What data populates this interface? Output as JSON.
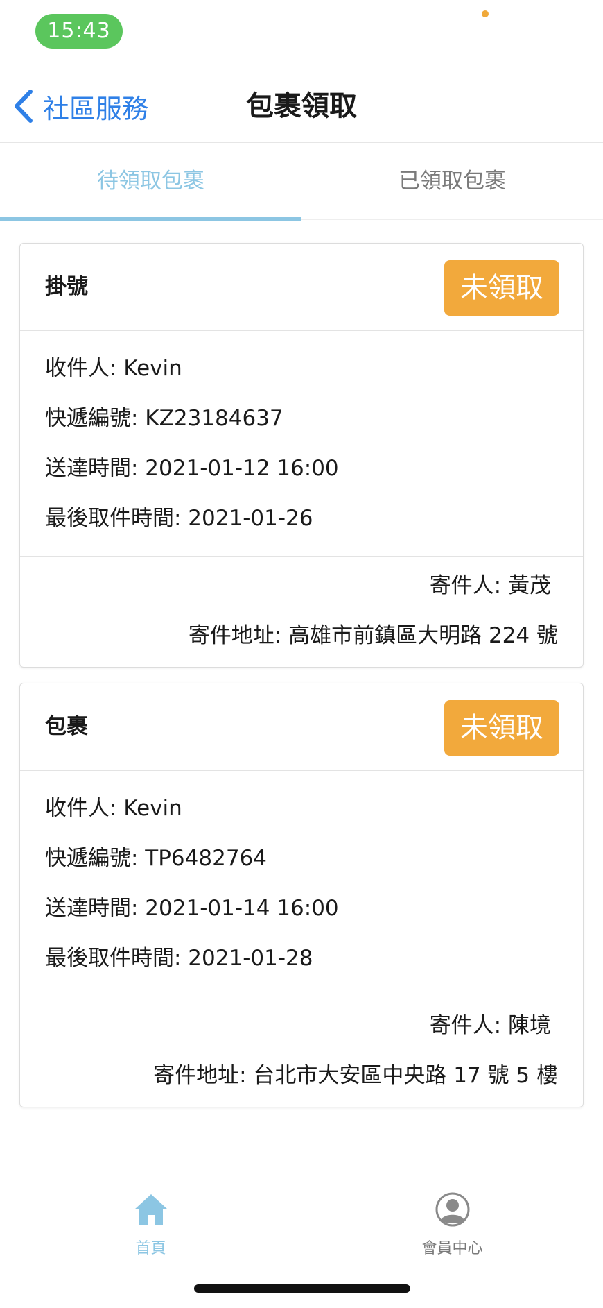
{
  "status_bar": {
    "time": "15:43"
  },
  "nav": {
    "back_label": "社區服務",
    "title": "包裹領取"
  },
  "tabs": [
    {
      "label": "待領取包裹",
      "active": true
    },
    {
      "label": "已領取包裹",
      "active": false
    }
  ],
  "colors": {
    "accent": "#8cc6e3",
    "back_link": "#2f80e7",
    "status_button": "#f2a93c",
    "time_pill": "#5bc65d"
  },
  "packages": [
    {
      "type": "掛號",
      "status": "未領取",
      "recipient": "收件人: Kevin",
      "tracking": "快遞編號: KZ23184637",
      "delivered": "送達時間: 2021-01-12 16:00",
      "deadline": "最後取件時間: 2021-01-26",
      "sender": "寄件人: 黃茂",
      "sender_address": "寄件地址: 高雄市前鎮區大明路 224 號"
    },
    {
      "type": "包裹",
      "status": "未領取",
      "recipient": "收件人: Kevin",
      "tracking": "快遞編號: TP6482764",
      "delivered": "送達時間: 2021-01-14 16:00",
      "deadline": "最後取件時間: 2021-01-28",
      "sender": "寄件人: 陳境",
      "sender_address": "寄件地址: 台北市大安區中央路 17 號 5 樓"
    }
  ],
  "tabbar": [
    {
      "label": "首頁",
      "icon": "home-icon",
      "active": true
    },
    {
      "label": "會員中心",
      "icon": "user-icon",
      "active": false
    }
  ]
}
